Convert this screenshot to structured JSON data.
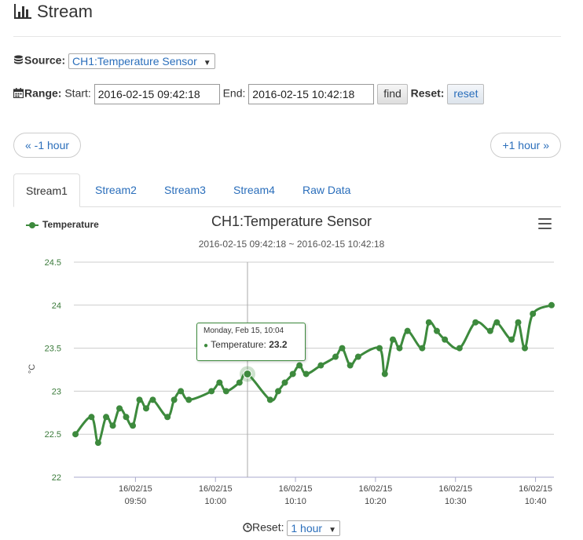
{
  "header": {
    "title": "Stream"
  },
  "source": {
    "label": "Source:",
    "selected": "CH1:Temperature Sensor"
  },
  "range": {
    "label": "Range:",
    "start_label": "Start:",
    "start_value": "2016-02-15 09:42:18",
    "end_label": "End:",
    "end_value": "2016-02-15 10:42:18",
    "find_label": "find",
    "reset_label": "Reset:",
    "reset_button": "reset"
  },
  "nav": {
    "prev": "« -1 hour",
    "next": "+1 hour »"
  },
  "tabs": [
    {
      "label": "Stream1",
      "active": true
    },
    {
      "label": "Stream2",
      "active": false
    },
    {
      "label": "Stream3",
      "active": false
    },
    {
      "label": "Stream4",
      "active": false
    },
    {
      "label": "Raw Data",
      "active": false
    }
  ],
  "tooltip": {
    "date": "Monday, Feb 15, 10:04",
    "series": "Temperature:",
    "value": "23.2"
  },
  "footer": {
    "reset_label": "Reset:",
    "reset_value": "1 hour"
  },
  "colors": {
    "series": "#3d8a3d",
    "link": "#2a6ebb"
  },
  "icons": [
    "bar-chart-icon",
    "database-icon",
    "calendar-icon",
    "clock-icon",
    "menu-icon"
  ],
  "chart_data": {
    "type": "line",
    "title": "CH1:Temperature Sensor",
    "subtitle": "2016-02-15 09:42:18 ~ 2016-02-15 10:42:18",
    "ylabel": "°C",
    "ylim": [
      22,
      24.5
    ],
    "yticks": [
      22,
      22.5,
      23,
      23.5,
      24,
      24.5
    ],
    "xlim": [
      "2016-02-15 09:42:18",
      "2016-02-15 10:42:18"
    ],
    "xticks": [
      {
        "time": "09:50",
        "label1": "16/02/15",
        "label2": "09:50"
      },
      {
        "time": "10:00",
        "label1": "16/02/15",
        "label2": "10:00"
      },
      {
        "time": "10:10",
        "label1": "16/02/15",
        "label2": "10:10"
      },
      {
        "time": "10:20",
        "label1": "16/02/15",
        "label2": "10:20"
      },
      {
        "time": "10:30",
        "label1": "16/02/15",
        "label2": "10:30"
      },
      {
        "time": "10:40",
        "label1": "16/02/15",
        "label2": "10:40"
      }
    ],
    "legend": "top-left",
    "grid": true,
    "series": [
      {
        "name": "Temperature",
        "points": [
          [
            "09:42:30",
            22.5
          ],
          [
            "09:44:30",
            22.7
          ],
          [
            "09:45:20",
            22.4
          ],
          [
            "09:46:20",
            22.7
          ],
          [
            "09:47:10",
            22.6
          ],
          [
            "09:48:00",
            22.8
          ],
          [
            "09:48:50",
            22.7
          ],
          [
            "09:49:40",
            22.6
          ],
          [
            "09:50:30",
            22.9
          ],
          [
            "09:51:20",
            22.8
          ],
          [
            "09:52:10",
            22.9
          ],
          [
            "09:54:00",
            22.7
          ],
          [
            "09:54:50",
            22.9
          ],
          [
            "09:55:40",
            23.0
          ],
          [
            "09:56:40",
            22.9
          ],
          [
            "09:59:30",
            23.0
          ],
          [
            "10:00:30",
            23.1
          ],
          [
            "10:01:20",
            23.0
          ],
          [
            "10:03:00",
            23.1
          ],
          [
            "10:04:00",
            23.2
          ],
          [
            "10:06:50",
            22.9
          ],
          [
            "10:07:50",
            23.0
          ],
          [
            "10:08:40",
            23.1
          ],
          [
            "10:09:40",
            23.2
          ],
          [
            "10:10:30",
            23.3
          ],
          [
            "10:11:20",
            23.2
          ],
          [
            "10:13:10",
            23.3
          ],
          [
            "10:15:00",
            23.4
          ],
          [
            "10:15:50",
            23.5
          ],
          [
            "10:16:50",
            23.3
          ],
          [
            "10:17:50",
            23.4
          ],
          [
            "10:20:30",
            23.5
          ],
          [
            "10:21:10",
            23.2
          ],
          [
            "10:22:10",
            23.6
          ],
          [
            "10:23:00",
            23.5
          ],
          [
            "10:24:00",
            23.7
          ],
          [
            "10:25:50",
            23.5
          ],
          [
            "10:26:40",
            23.8
          ],
          [
            "10:27:40",
            23.7
          ],
          [
            "10:28:40",
            23.6
          ],
          [
            "10:30:30",
            23.5
          ],
          [
            "10:32:30",
            23.8
          ],
          [
            "10:34:20",
            23.7
          ],
          [
            "10:35:10",
            23.8
          ],
          [
            "10:37:00",
            23.6
          ],
          [
            "10:37:50",
            23.8
          ],
          [
            "10:38:40",
            23.5
          ],
          [
            "10:39:40",
            23.9
          ],
          [
            "10:42:00",
            24.0
          ]
        ]
      }
    ]
  }
}
